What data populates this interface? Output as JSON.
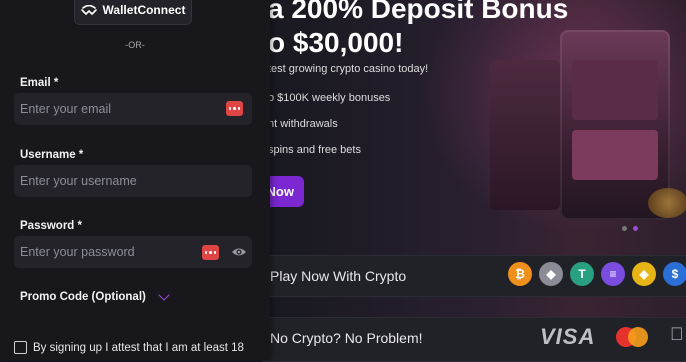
{
  "promo": {
    "headline_line1": "a 200% Deposit Bonus",
    "headline_line2": "o $30,000!",
    "subline": "test growing crypto casino today!",
    "bullets": [
      "o $100K weekly bonuses",
      "nt withdrawals",
      "spins and free bets"
    ],
    "cta_label": "Now",
    "strip1_label": "Play Now With Crypto",
    "strip2_label": "No Crypto? No Problem!",
    "visa_label": "VISA",
    "crypto_icons": [
      {
        "name": "bitcoin-icon",
        "glyph": "₿",
        "color": "#f0901c"
      },
      {
        "name": "ethereum-icon",
        "glyph": "◆",
        "color": "#8c8c96"
      },
      {
        "name": "tether-icon",
        "glyph": "T",
        "color": "#2aa082"
      },
      {
        "name": "solana-icon",
        "glyph": "≡",
        "color": "#7a4de0"
      },
      {
        "name": "bnb-icon",
        "glyph": "◈",
        "color": "#e7b416"
      },
      {
        "name": "usdc-icon",
        "glyph": "$",
        "color": "#2a6fd6"
      }
    ],
    "colors": {
      "accent": "#7b27d2",
      "apple": "#bfc0c6"
    }
  },
  "form": {
    "walletconnect_label": "WalletConnect",
    "or_divider": "-OR-",
    "email_label": "Email *",
    "email_placeholder": "Enter your email",
    "username_label": "Username *",
    "username_placeholder": "Enter your username",
    "password_label": "Password *",
    "password_placeholder": "Enter your password",
    "promo_code_label": "Promo Code (Optional)",
    "terms_text": "By signing up I attest that I am at least 18"
  }
}
